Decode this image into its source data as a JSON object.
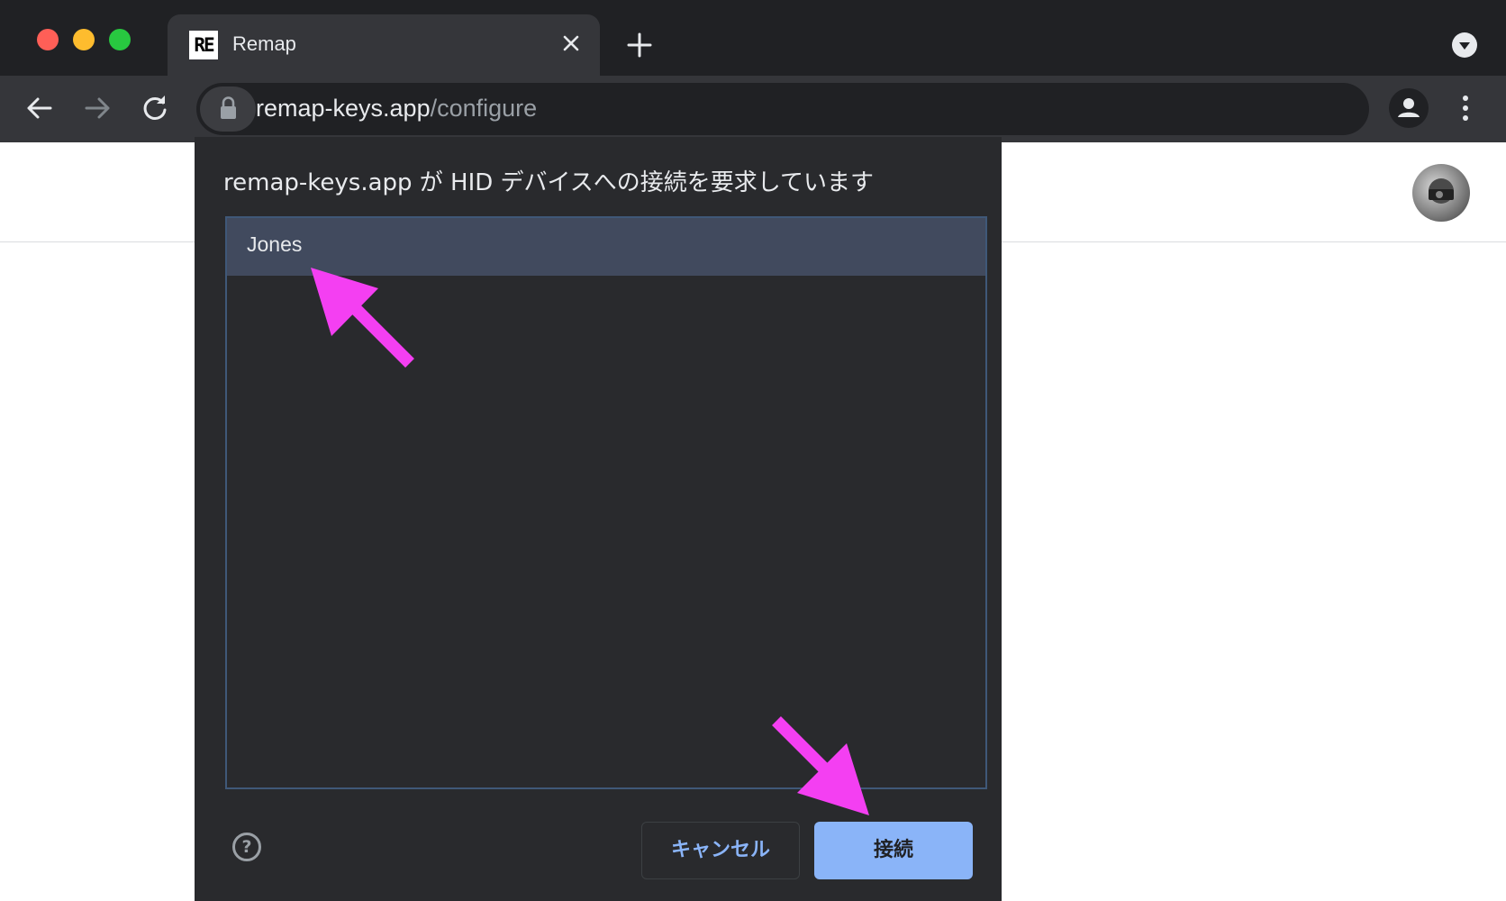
{
  "browser": {
    "tab": {
      "favicon_text": "RE",
      "title": "Remap"
    },
    "address_bar": {
      "host": "remap-keys.app",
      "path": "/configure"
    }
  },
  "dialog": {
    "title": "remap-keys.app が HID デバイスへの接続を要求しています",
    "devices": [
      {
        "label": "Jones",
        "selected": true
      }
    ],
    "help_icon_glyph": "?",
    "cancel_label": "キャンセル",
    "connect_label": "接続"
  },
  "colors": {
    "annotation_arrow": "#f43ff2",
    "accent_button": "#8ab4f8",
    "selected_row": "#414a5e",
    "dialog_bg": "#292a2d"
  }
}
